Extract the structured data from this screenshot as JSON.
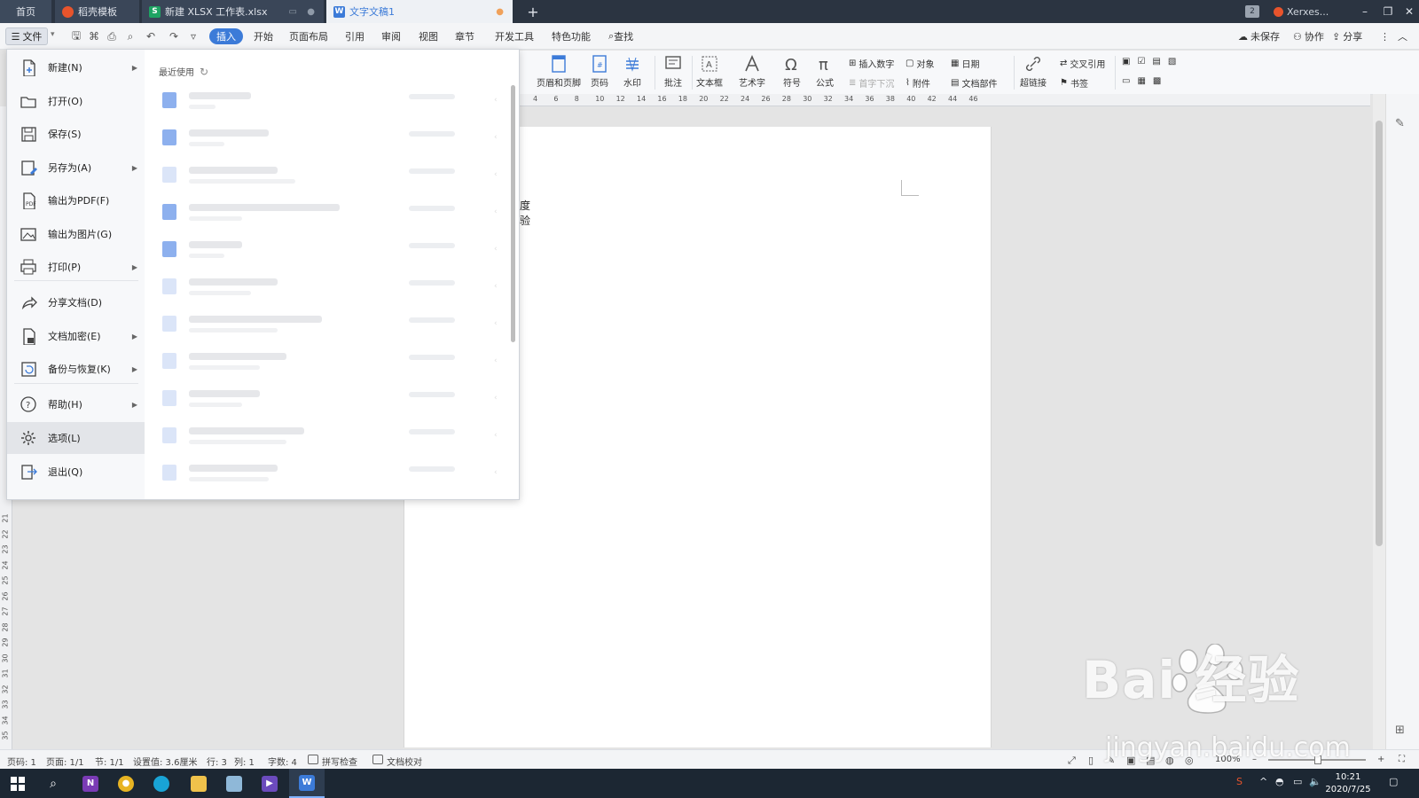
{
  "tabs": {
    "home": "首页",
    "docer": "稻壳模板",
    "xlsx": "新建 XLSX 工作表.xlsx",
    "doc": "文字文稿1",
    "badge": "2",
    "user": "Xerxes..."
  },
  "menubar": {
    "file": "文件",
    "items": [
      "插入",
      "开始",
      "页面布局",
      "引用",
      "审阅",
      "视图",
      "章节",
      "开发工具",
      "特色功能"
    ],
    "search": "查找",
    "unsaved": "未保存",
    "collab": "协作",
    "share": "分享"
  },
  "ribbon": {
    "header_footer": "页眉和页脚",
    "page_num": "页码",
    "watermark": "水印",
    "comment": "批注",
    "textbox": "文本框",
    "wordart": "艺术字",
    "symbol": "符号",
    "formula": "公式",
    "insert_number": "插入数字",
    "object": "对象",
    "date": "日期",
    "drop_cap": "首字下沉",
    "attachment": "附件",
    "doc_parts": "文档部件",
    "hyperlink": "超链接",
    "cross_ref": "交叉引用",
    "bookmark": "书签"
  },
  "ruler": {
    "h": [
      "4",
      "6",
      "8",
      "10",
      "12",
      "14",
      "16",
      "18",
      "20",
      "22",
      "24",
      "26",
      "28",
      "30",
      "32",
      "34",
      "36",
      "38",
      "40",
      "42",
      "44",
      "46"
    ],
    "v": [
      "21",
      "22",
      "23",
      "24",
      "25",
      "26",
      "27",
      "28",
      "29",
      "30",
      "31",
      "32",
      "33",
      "34",
      "35"
    ]
  },
  "document": {
    "line1": "度",
    "line2": "验"
  },
  "file_menu": {
    "items": [
      {
        "label": "新建(N)",
        "icon": "new-doc-icon",
        "arrow": true
      },
      {
        "label": "打开(O)",
        "icon": "folder-open-icon",
        "arrow": false
      },
      {
        "label": "保存(S)",
        "icon": "save-icon",
        "arrow": false
      },
      {
        "label": "另存为(A)",
        "icon": "save-as-icon",
        "arrow": true
      },
      {
        "label": "输出为PDF(F)",
        "icon": "pdf-export-icon",
        "arrow": false
      },
      {
        "label": "输出为图片(G)",
        "icon": "image-export-icon",
        "arrow": false
      },
      {
        "label": "打印(P)",
        "icon": "print-icon",
        "arrow": true
      },
      {
        "label": "分享文档(D)",
        "icon": "share-doc-icon",
        "arrow": false
      },
      {
        "label": "文档加密(E)",
        "icon": "encrypt-icon",
        "arrow": true
      },
      {
        "label": "备份与恢复(K)",
        "icon": "backup-icon",
        "arrow": true
      },
      {
        "label": "帮助(H)",
        "icon": "help-icon",
        "arrow": true
      },
      {
        "label": "选项(L)",
        "icon": "gear-icon",
        "arrow": false
      },
      {
        "label": "退出(Q)",
        "icon": "exit-icon",
        "arrow": false
      }
    ],
    "recent_title": "最近使用"
  },
  "statusbar": {
    "page": "页码: 1",
    "pages": "页面: 1/1",
    "section": "节: 1/1",
    "setting": "设置值: 3.6厘米",
    "row": "行: 3",
    "col": "列: 1",
    "words": "字数: 4",
    "spell": "拼写检查",
    "proof": "文档校对",
    "zoom": "100%"
  },
  "taskbar": {
    "time": "10:21",
    "date": "2020/7/25"
  },
  "watermark": {
    "brand": "Bai 经验",
    "url": "jingyan.baidu.com"
  },
  "colors": {
    "accent": "#3c7bd8",
    "titlebar": "#2b3441",
    "taskbar": "#1c2733"
  }
}
